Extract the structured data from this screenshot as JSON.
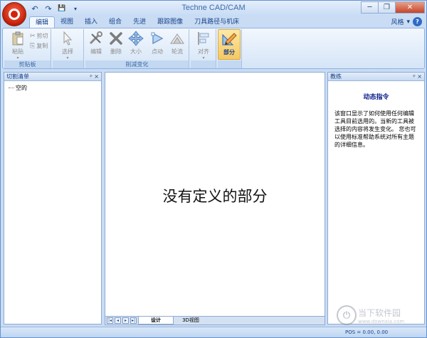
{
  "window": {
    "title": "Techne CAD/CAM"
  },
  "qat": {
    "undo_icon": "↶",
    "redo_icon": "↷",
    "save_icon": "💾",
    "more_icon": "▾"
  },
  "window_controls": {
    "minimize": "─",
    "restore": "❐",
    "close": "✕"
  },
  "ribbon_tabs": [
    "编辑",
    "视图",
    "插入",
    "组合",
    "先进",
    "跟踪图像",
    "刀具路径与机床"
  ],
  "ribbon_right": {
    "style_label": "风格",
    "style_arrow": "▾",
    "help": "?"
  },
  "ribbon": {
    "clipboard": {
      "label": "剪贴板",
      "paste": "粘贴",
      "cut": "剪切",
      "copy": "复制"
    },
    "select": {
      "label": "选择"
    },
    "cut_change": {
      "label": "削减变化",
      "edit": "编辑",
      "delete": "删除",
      "size": "大小",
      "point": "点动",
      "flow": "轮流"
    },
    "align": {
      "label": "对齐"
    },
    "part": {
      "label": "部分"
    }
  },
  "left_pane": {
    "title": "切割清单",
    "pin": "ᵖ × ",
    "tree_item": "空的"
  },
  "center_pane": {
    "message": "没有定义的部分",
    "nav": [
      "|◂",
      "◂",
      "▸",
      "▸|"
    ],
    "tabs": [
      "设计",
      "3D视图"
    ]
  },
  "right_pane": {
    "title": "教练",
    "pin": "ᵖ × ",
    "heading": "动态指令",
    "body": "该窗口显示了如何使用任何编辑工具目前选用的。当新的工具被选择的内容将发生变化。  您也可以使用标准帮助系统对所有主题的详细信息。"
  },
  "status": {
    "pos": "POS = 0.00, 0.00"
  },
  "watermark": {
    "icon": "⏻",
    "text": "当下软件园",
    "url": "www.downxia.com"
  },
  "colors": {
    "orb": "#d2220c",
    "accent": "#15428b",
    "heading": "#0c1e8e"
  }
}
